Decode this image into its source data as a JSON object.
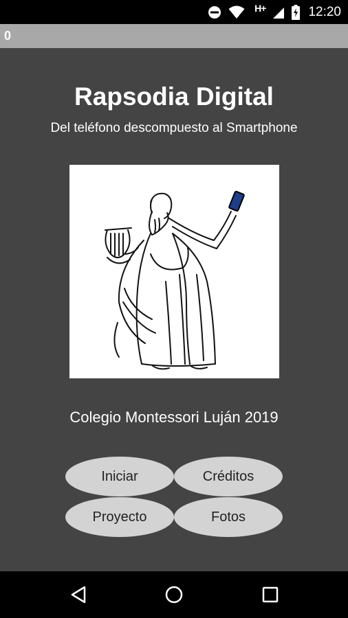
{
  "status_bar": {
    "time": "12:20",
    "network": "H+",
    "icons": [
      "do-not-disturb-icon",
      "wifi-icon",
      "signal-icon",
      "battery-charging-icon"
    ]
  },
  "title_bar": {
    "text": "0"
  },
  "main": {
    "title": "Rapsodia Digital",
    "subtitle": "Del teléfono descompuesto al Smartphone",
    "image": "illustration of a classical bard holding a lyre and a smartphone",
    "school": "Colegio Montessori Luján 2019"
  },
  "buttons": {
    "iniciar": "Iniciar",
    "creditos": "Créditos",
    "proyecto": "Proyecto",
    "fotos": "Fotos"
  },
  "nav_bar": {
    "icons": [
      "back-icon",
      "home-icon",
      "recents-icon"
    ]
  },
  "colors": {
    "background": "#444444",
    "title_bar": "#a8a8a8",
    "button": "#d3d3d3",
    "system_bars": "#000000"
  }
}
